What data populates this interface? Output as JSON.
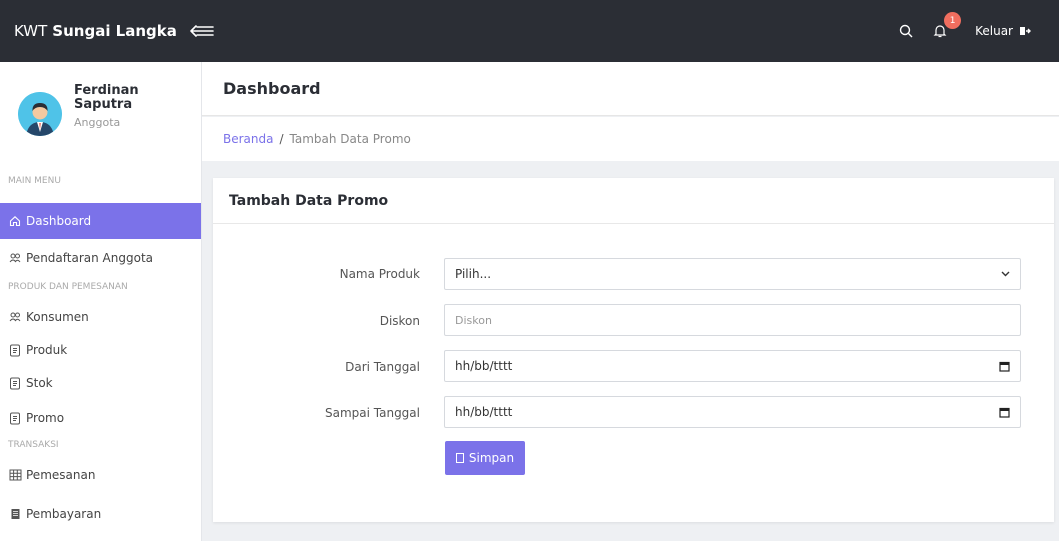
{
  "topbar": {
    "brand_prefix": "KWT",
    "brand_name": "Sungai Langka",
    "notification_count": "1",
    "logout_label": "Keluar"
  },
  "sidebar": {
    "profile_name": "Ferdinan Saputra",
    "profile_role": "Anggota",
    "sections": {
      "main": "MAIN MENU",
      "produk": "PRODUK DAN PEMESANAN",
      "transaksi": "TRANSAKSI"
    },
    "items": [
      {
        "label": "Dashboard",
        "icon": "home-icon"
      },
      {
        "label": "Pendaftaran Anggota",
        "icon": "users-icon"
      },
      {
        "label": "Konsumen",
        "icon": "users-icon"
      },
      {
        "label": "Produk",
        "icon": "document-icon"
      },
      {
        "label": "Stok",
        "icon": "document-icon"
      },
      {
        "label": "Promo",
        "icon": "document-icon"
      },
      {
        "label": "Pemesanan",
        "icon": "table-icon"
      },
      {
        "label": "Pembayaran",
        "icon": "receipt-icon"
      }
    ],
    "accent": "#7b72e9"
  },
  "header": {
    "title": "Dashboard"
  },
  "breadcrumb": {
    "home": "Beranda",
    "separator": "/",
    "current": "Tambah Data Promo"
  },
  "card": {
    "title": "Tambah Data Promo"
  },
  "form": {
    "produk": {
      "label": "Nama Produk",
      "value": "Pilih..."
    },
    "diskon": {
      "label": "Diskon",
      "placeholder": "Diskon"
    },
    "dari": {
      "label": "Dari Tanggal",
      "value": "hh/bb/tttt"
    },
    "sampai": {
      "label": "Sampai Tanggal",
      "value": "hh/bb/tttt"
    },
    "save_label": "Simpan"
  }
}
